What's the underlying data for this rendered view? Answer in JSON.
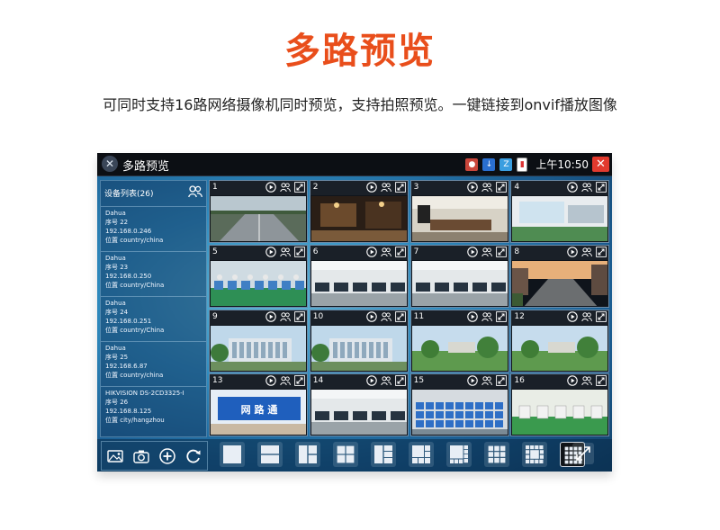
{
  "headline": "多路预览",
  "subline": "可同时支持16路网络摄像机同时预览，支持拍照预览。一键链接到onvif播放图像",
  "app": {
    "title": "多路预览",
    "clock": "上午10:50"
  },
  "sidebar": {
    "title": "设备列表(26)",
    "devices": [
      {
        "brand": "Dahua",
        "serial": "序号  22",
        "ip": "192.168.0.246",
        "location": "位置  country/china"
      },
      {
        "brand": "Dahua",
        "serial": "序号  23",
        "ip": "192.168.0.250",
        "location": "位置  country/China"
      },
      {
        "brand": "Dahua",
        "serial": "序号  24",
        "ip": "192.168.0.251",
        "location": "位置  country/China"
      },
      {
        "brand": "Dahua",
        "serial": "序号  25",
        "ip": "192.168.6.87",
        "location": "位置  country/china"
      },
      {
        "brand": "HIKVISION DS-2CD3325-I",
        "serial": "序号  26",
        "ip": "192.168.8.125",
        "location": "位置  city/hangzhou"
      }
    ]
  },
  "cells": [
    {
      "num": "1",
      "scene": "road"
    },
    {
      "num": "2",
      "scene": "lobby"
    },
    {
      "num": "3",
      "scene": "meeting"
    },
    {
      "num": "4",
      "scene": "room"
    },
    {
      "num": "5",
      "scene": "workshop"
    },
    {
      "num": "6",
      "scene": "office"
    },
    {
      "num": "7",
      "scene": "office"
    },
    {
      "num": "8",
      "scene": "street"
    },
    {
      "num": "9",
      "scene": "building"
    },
    {
      "num": "10",
      "scene": "building"
    },
    {
      "num": "11",
      "scene": "park"
    },
    {
      "num": "12",
      "scene": "park"
    },
    {
      "num": "13",
      "scene": "sign",
      "sign_text": "网 路 通"
    },
    {
      "num": "14",
      "scene": "office"
    },
    {
      "num": "15",
      "scene": "warehouse"
    },
    {
      "num": "16",
      "scene": "factory"
    }
  ],
  "tools": [
    "image-icon",
    "camera-icon",
    "add-icon",
    "refresh-icon"
  ],
  "layouts": [
    "1",
    "2",
    "3",
    "4",
    "5",
    "6",
    "8",
    "9",
    "13",
    "16"
  ],
  "active_layout": "16",
  "colors": {
    "headline": "#e94e1b",
    "close": "#e23a2e"
  }
}
